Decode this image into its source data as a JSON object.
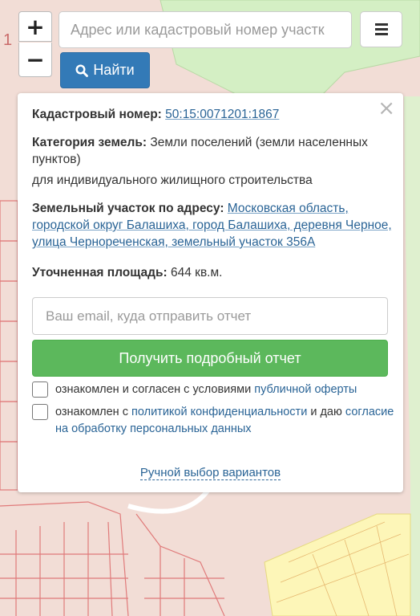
{
  "map": {
    "colors": {
      "background": "#f2ddd6",
      "green_zone": "#d4efc4",
      "yellow_zone": "#fdf6b8",
      "parcel_outline": "#e07a7a",
      "road": "#ffffff"
    },
    "labels": {
      "top_left_number": "1"
    }
  },
  "controls": {
    "zoom_in_label": "+",
    "zoom_out_label": "−",
    "search_placeholder": "Адрес или кадастровый номер участк",
    "menu_icon": "hamburger-icon",
    "find_label": "Найти",
    "find_icon": "search-icon"
  },
  "panel": {
    "close_label": "×",
    "cadastral_label": "Кадастровый номер:",
    "cadastral_number": "50:15:0071201:1867",
    "category_label": "Категория земель:",
    "category_value": "Земли поселений (земли населенных пунктов)",
    "usage": "для индивидуального жилищного строительства",
    "address_label": "Земельный участок по адресу:",
    "address_value": "Московская область, городской округ Балашиха, город Балашиха, деревня Черное, улица Чернореченская, земельный участок 356А",
    "area_label": "Уточненная площадь:",
    "area_value": "644 кв.м.",
    "email_placeholder": "Ваш email, куда отправить отчет",
    "report_button": "Получить подробный отчет",
    "consent_1_text": "ознакомлен и согласен с условиями",
    "consent_1_link": "публичной оферты",
    "consent_2_prefix": "ознакомлен с",
    "consent_2_link": "политикой конфиденциальности",
    "consent_2_middle": "и даю",
    "consent_2_link2": "согласие на обработку персональных данных",
    "manual_link": "Ручной выбор вариантов"
  },
  "colors": {
    "primary_blue": "#337ab7",
    "success_green": "#5cb85c",
    "link_blue": "#2a6496"
  }
}
